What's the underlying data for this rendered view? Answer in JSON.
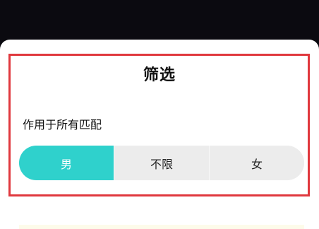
{
  "filter_sheet": {
    "title": "筛选",
    "scope_label": "作用于所有匹配",
    "gender_options": [
      {
        "label": "男",
        "selected": true
      },
      {
        "label": "不限",
        "selected": false
      },
      {
        "label": "女",
        "selected": false
      }
    ]
  },
  "colors": {
    "accent": "#2fd1cc",
    "highlight_border": "#e0383e",
    "segment_bg": "#ececec",
    "top_bar": "#0b0a10"
  }
}
